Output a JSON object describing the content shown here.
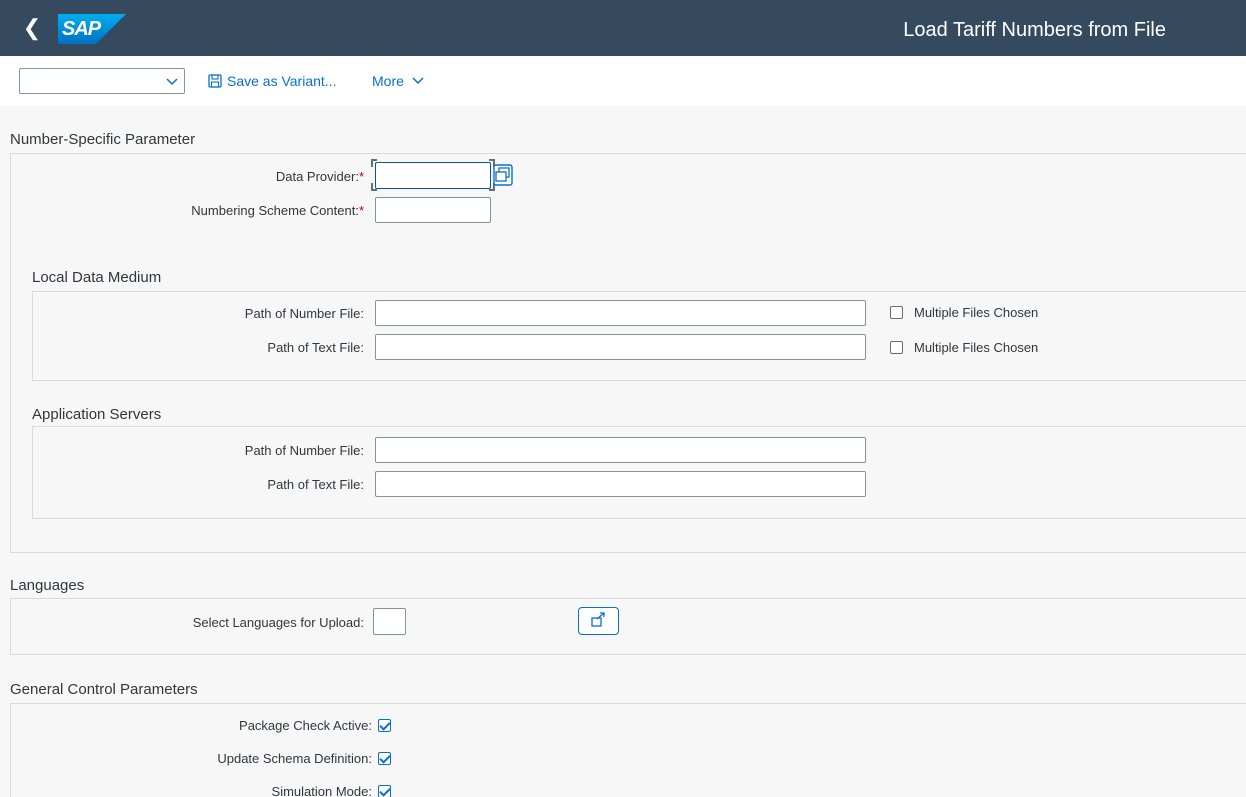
{
  "shell": {
    "logo_text": "SAP",
    "title": "Load Tariff Numbers from File"
  },
  "toolbar": {
    "variant_value": "",
    "save_variant_label": "Save as Variant...",
    "more_label": "More"
  },
  "number_specific": {
    "title": "Number-Specific Parameter",
    "data_provider_label": "Data Provider:",
    "numbering_scheme_label": "Numbering Scheme Content:",
    "data_provider_value": "",
    "numbering_scheme_value": ""
  },
  "local_data_medium": {
    "title": "Local Data Medium",
    "number_file_label": "Path of Number File:",
    "text_file_label": "Path of Text File:",
    "number_file_value": "",
    "text_file_value": "",
    "multiple_files_label_1": "Multiple Files Chosen",
    "multiple_files_label_2": "Multiple Files Chosen",
    "multiple_files_1_checked": false,
    "multiple_files_2_checked": false
  },
  "application_servers": {
    "title": "Application Servers",
    "number_file_label": "Path of Number File:",
    "text_file_label": "Path of Text File:",
    "number_file_value": "",
    "text_file_value": ""
  },
  "languages": {
    "title": "Languages",
    "select_label": "Select Languages for Upload:",
    "select_value": ""
  },
  "general_control": {
    "title": "General Control Parameters",
    "package_check_label": "Package Check Active:",
    "update_schema_label": "Update Schema Definition:",
    "simulation_mode_label": "Simulation Mode:",
    "package_check_checked": true,
    "update_schema_checked": true,
    "simulation_mode_checked": true
  },
  "colors": {
    "shell_bg": "#354a5f",
    "accent": "#0a6ed1",
    "required": "#bb0000"
  }
}
